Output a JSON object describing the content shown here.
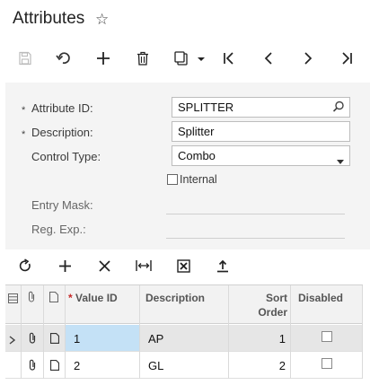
{
  "page": {
    "title": "Attributes",
    "favorite_icon": "star-icon"
  },
  "toolbar": {
    "items": [
      {
        "name": "save-icon"
      },
      {
        "name": "undo-icon"
      },
      {
        "name": "add-icon"
      },
      {
        "name": "delete-icon"
      },
      {
        "name": "copy-paste-icon"
      },
      {
        "name": "first-record-icon"
      },
      {
        "name": "previous-record-icon"
      },
      {
        "name": "next-record-icon"
      },
      {
        "name": "last-record-icon"
      }
    ]
  },
  "form": {
    "attribute_id_label": "Attribute ID:",
    "attribute_id_value": "SPLITTER",
    "description_label": "Description:",
    "description_value": "Splitter",
    "control_type_label": "Control Type:",
    "control_type_value": "Combo",
    "internal_label": "Internal",
    "internal_checked": false,
    "entry_mask_label": "Entry Mask:",
    "entry_mask_value": "",
    "reg_exp_label": "Reg. Exp.:",
    "reg_exp_value": "",
    "required_mark": "*"
  },
  "grid": {
    "toolbar": [
      "refresh-icon",
      "add-row-icon",
      "delete-row-icon",
      "fit-to-screen-icon",
      "export-excel-icon",
      "upload-icon"
    ],
    "columns": {
      "value_id": "Value ID",
      "value_id_required": "*",
      "description": "Description",
      "sort_order_line1": "Sort",
      "sort_order_line2": "Order",
      "disabled": "Disabled"
    },
    "rows": [
      {
        "value_id": "1",
        "description": "AP",
        "sort_order": "1",
        "disabled": false,
        "selected": true
      },
      {
        "value_id": "2",
        "description": "GL",
        "sort_order": "2",
        "disabled": false,
        "selected": false
      }
    ]
  },
  "colors": {
    "selected_row": "#e6e6e6",
    "selected_cell": "#c4e1f6",
    "required_mark": "#c62828",
    "header_bg": "#f2f2f2"
  }
}
